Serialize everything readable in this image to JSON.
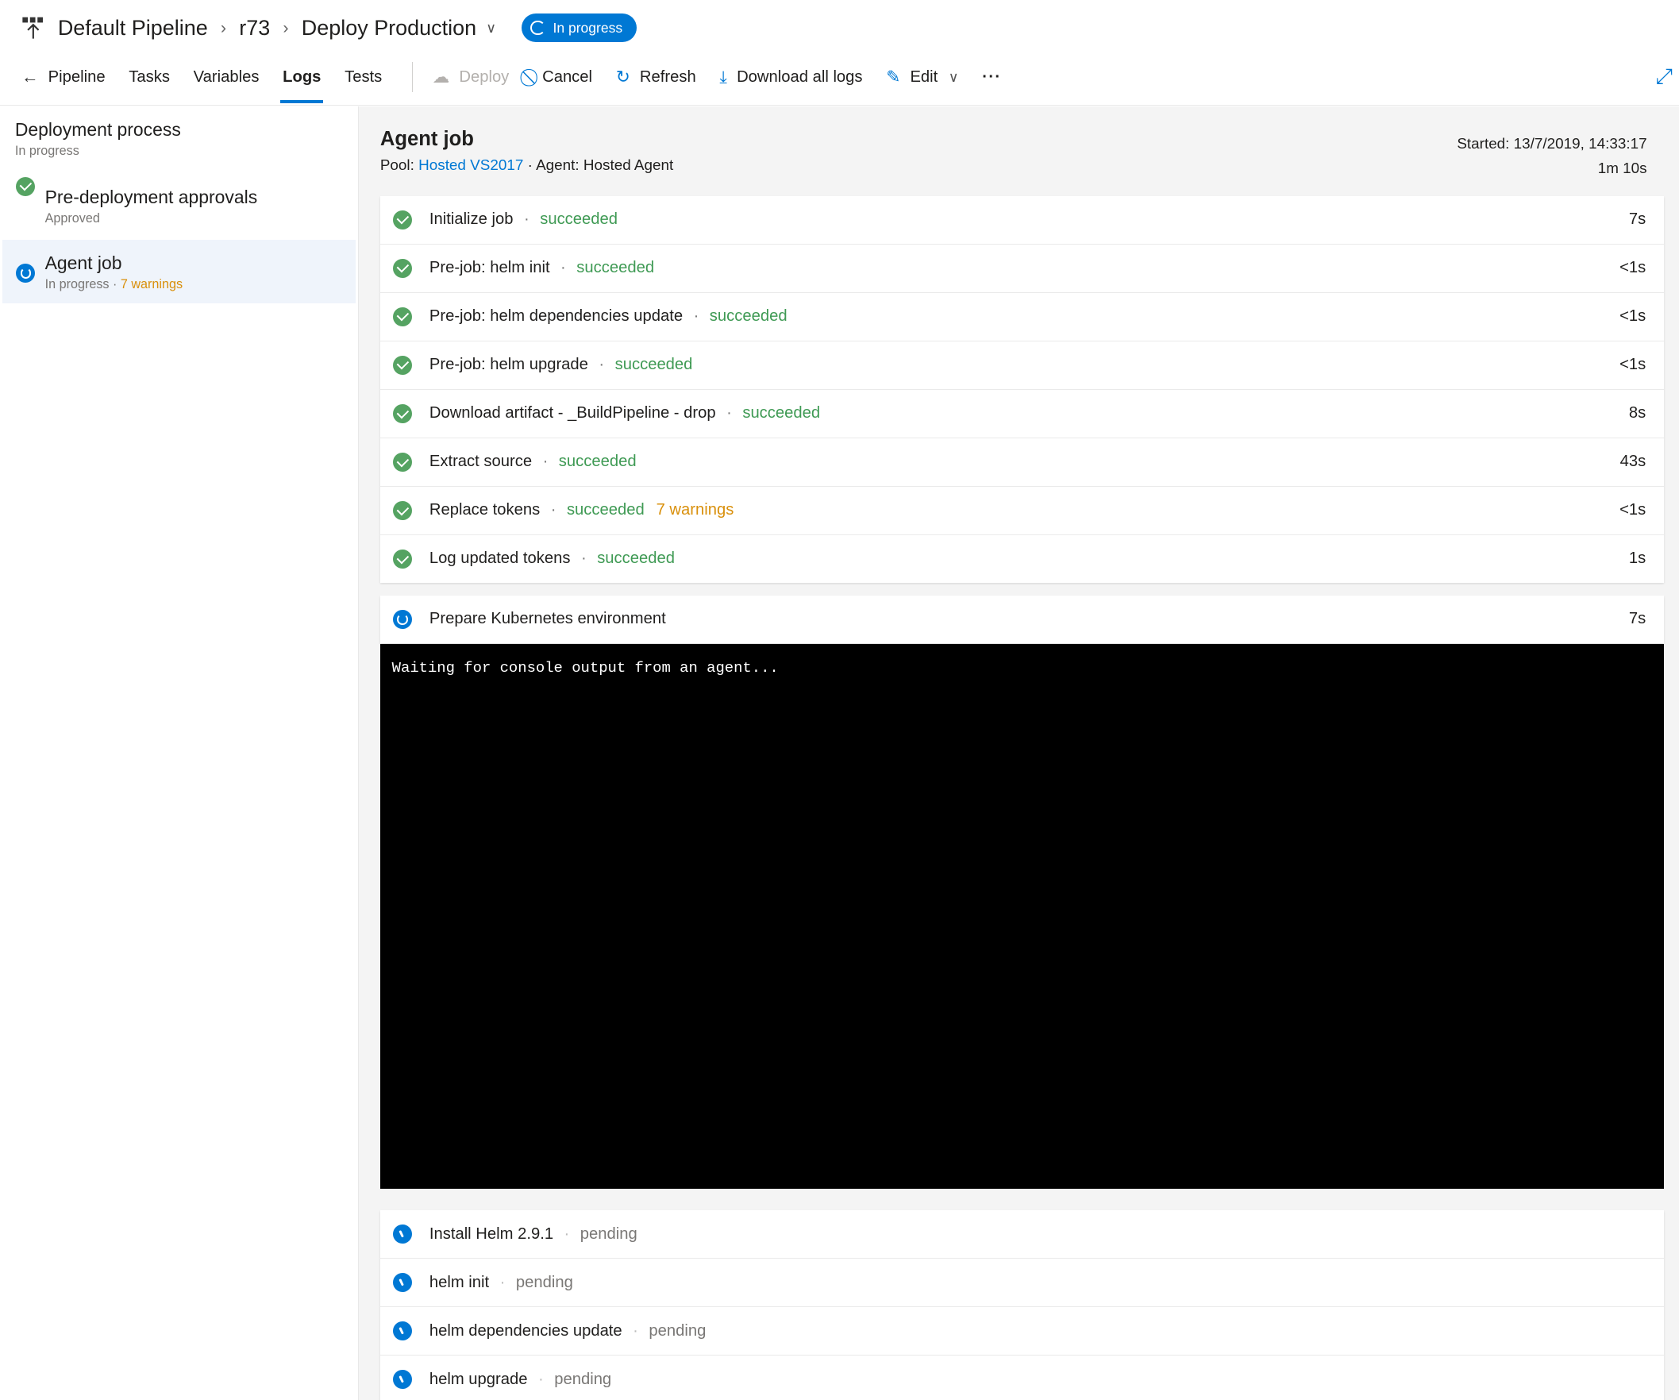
{
  "header": {
    "breadcrumb": [
      "Default Pipeline",
      "r73",
      "Deploy Production"
    ],
    "status_badge": "In progress",
    "brand_color": "#0078d4"
  },
  "toolbar": {
    "tabs": [
      {
        "label": "Pipeline",
        "icon": "arrow-left-icon"
      },
      {
        "label": "Tasks"
      },
      {
        "label": "Variables"
      },
      {
        "label": "Logs",
        "selected": true
      },
      {
        "label": "Tests"
      }
    ],
    "actions": [
      {
        "label": "Deploy",
        "icon": "cloud-icon",
        "disabled": true
      },
      {
        "label": "Cancel",
        "icon": "cancel-icon"
      },
      {
        "label": "Refresh",
        "icon": "refresh-icon"
      },
      {
        "label": "Download all logs",
        "icon": "download-icon"
      },
      {
        "label": "Edit",
        "icon": "pencil-icon"
      }
    ],
    "more": "···"
  },
  "sidebar": {
    "title": "Deployment process",
    "subtitle": "In progress",
    "items": [
      {
        "name": "Pre-deployment approvals",
        "status": "Approved",
        "state": "succeeded"
      },
      {
        "name": "Agent job",
        "status": "In progress",
        "sep": " · ",
        "warnings": "7 warnings",
        "state": "in-progress"
      }
    ]
  },
  "job": {
    "title": "Agent job",
    "pool_label": "Pool: ",
    "pool": "Hosted VS2017",
    "agent": " · Agent: Hosted Agent",
    "started": "Started: 13/7/2019, 14:33:17",
    "duration": "1m 10s"
  },
  "completed_tasks": [
    {
      "name": "Initialize job",
      "status": "succeeded",
      "duration": "7s"
    },
    {
      "name": "Pre-job: helm init",
      "status": "succeeded",
      "duration": "<1s"
    },
    {
      "name": "Pre-job: helm dependencies update",
      "status": "succeeded",
      "duration": "<1s"
    },
    {
      "name": "Pre-job: helm upgrade",
      "status": "succeeded",
      "duration": "<1s"
    },
    {
      "name": "Download artifact - _BuildPipeline - drop",
      "status": "succeeded",
      "duration": "8s"
    },
    {
      "name": "Extract source",
      "status": "succeeded",
      "duration": "43s"
    },
    {
      "name": "Replace tokens",
      "status": "succeeded",
      "warnings": "7 warnings",
      "duration": "<1s"
    },
    {
      "name": "Log updated tokens",
      "status": "succeeded",
      "duration": "1s"
    }
  ],
  "running_task": {
    "name": "Prepare Kubernetes environment",
    "duration": "7s"
  },
  "console": {
    "text": "Waiting for console output from an agent..."
  },
  "pending_tasks": [
    {
      "name": "Install Helm 2.9.1",
      "status": "pending"
    },
    {
      "name": "helm init",
      "status": "pending"
    },
    {
      "name": "helm dependencies update",
      "status": "pending"
    },
    {
      "name": "helm upgrade",
      "status": "pending"
    }
  ]
}
